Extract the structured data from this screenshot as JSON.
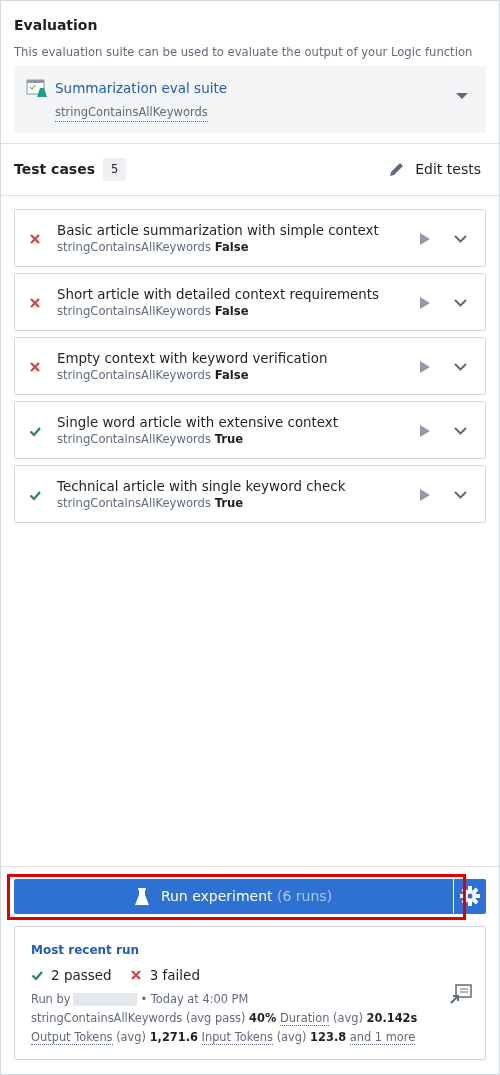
{
  "evaluation": {
    "title": "Evaluation",
    "description": "This evaluation suite can be used to evaluate the output of your Logic function",
    "suite": {
      "name": "Summarization eval suite",
      "evaluator": "stringContainsAllKeywords"
    }
  },
  "test_cases": {
    "title": "Test cases",
    "count": "5",
    "edit_label": "Edit tests",
    "items": [
      {
        "title": "Basic article summarization with simple context",
        "evaluator": "stringContainsAllKeywords",
        "result": "False",
        "passed": false
      },
      {
        "title": "Short article with detailed context requirements",
        "evaluator": "stringContainsAllKeywords",
        "result": "False",
        "passed": false
      },
      {
        "title": "Empty context with keyword verification",
        "evaluator": "stringContainsAllKeywords",
        "result": "False",
        "passed": false
      },
      {
        "title": "Single word article with extensive context",
        "evaluator": "stringContainsAllKeywords",
        "result": "True",
        "passed": true
      },
      {
        "title": "Technical article with single keyword check",
        "evaluator": "stringContainsAllKeywords",
        "result": "True",
        "passed": true
      }
    ]
  },
  "run_button": {
    "label": "Run experiment",
    "runs": "(6 runs)",
    "highlighted": true
  },
  "recent_run": {
    "title": "Most recent run",
    "passed": "2 passed",
    "failed": "3 failed",
    "run_by": "Run by",
    "run_by_redacted": true,
    "time": "• Today at 4:00 PM",
    "metrics": [
      {
        "label": "stringContainsAllKeywords",
        "qualifier": "(avg pass)",
        "value": "40%",
        "underlined": false
      },
      {
        "label": "Duration",
        "qualifier": "(avg)",
        "value": "20.142s",
        "underlined": true
      },
      {
        "label": "Output Tokens",
        "qualifier": "(avg)",
        "value": "1,271.6",
        "underlined": true
      },
      {
        "label": "Input Tokens",
        "qualifier": "(avg)",
        "value": "123.8",
        "underlined": true
      }
    ],
    "more_link": "and 1 more"
  }
}
